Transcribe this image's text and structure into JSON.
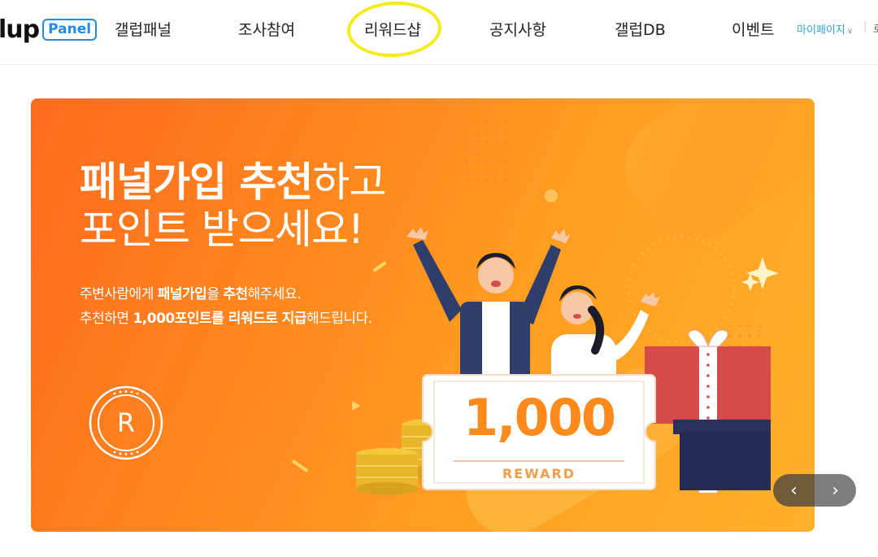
{
  "logo": {
    "word": "lup",
    "badge": "Panel"
  },
  "nav": {
    "items": [
      {
        "label": "갤럽패널"
      },
      {
        "label": "조사참여"
      },
      {
        "label": "리워드샵"
      },
      {
        "label": "공지사항"
      },
      {
        "label": "갤럽DB"
      },
      {
        "label": "이벤트"
      }
    ],
    "mypage": "마이페이지",
    "cut_text": "로"
  },
  "banner": {
    "title_strong_1": "패널가입 추천",
    "title_light_1": "하고",
    "title_line_2": "포인트 받으세요!",
    "desc_line1_pre": "주변사람에게 ",
    "desc_line1_b1": "패널가입",
    "desc_line1_mid": "을 ",
    "desc_line1_b2": "추천",
    "desc_line1_post": "해주세요.",
    "desc_line2_pre": "추천하면 ",
    "desc_line2_b1": "1,000포인트를 리워드로 지급",
    "desc_line2_post": "해드립니다.",
    "badge_letter": "R",
    "ticket_amount": "1,000",
    "ticket_label": "REWARD"
  },
  "carousel": {
    "prev": "‹",
    "next": "›"
  },
  "colors": {
    "brand_blue": "#1f8ce6",
    "mypage_blue": "#2ea3d8",
    "highlight_yellow": "#f4ec1c",
    "banner_orange": "#ff8a1e",
    "ticket_orange": "#ff8a1c"
  }
}
